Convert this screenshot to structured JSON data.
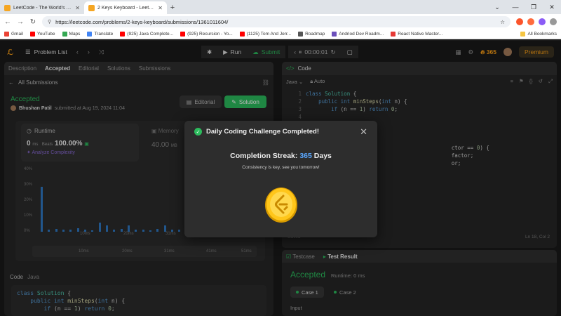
{
  "browser": {
    "tabs": [
      {
        "title": "LeetCode - The World's Leading Online Programming Learning Platform",
        "active": false
      },
      {
        "title": "2 Keys Keyboard - LeetCode",
        "active": true
      }
    ],
    "url": "https://leetcode.com/problems/2-keys-keyboard/submissions/1361011604/",
    "bookmarks": [
      {
        "label": "Gmail",
        "color": "#ea4335"
      },
      {
        "label": "YouTube",
        "color": "#ff0000"
      },
      {
        "label": "Maps",
        "color": "#34a853"
      },
      {
        "label": "Translate",
        "color": "#4285f4"
      },
      {
        "label": "(925) Java Complete...",
        "color": "#ff0000"
      },
      {
        "label": "(925) Recursion - Yo...",
        "color": "#ff0000"
      },
      {
        "label": "(1125) Tom And Jerr...",
        "color": "#ff0000"
      },
      {
        "label": "Roadmap",
        "color": "#555555"
      },
      {
        "label": "Andriod Dev Roadm...",
        "color": "#6b4fbb"
      },
      {
        "label": "React Native Master...",
        "color": "#e53935"
      }
    ],
    "all_bookmarks": "All Bookmarks"
  },
  "topbar": {
    "problem_list": "Problem List",
    "run": "Run",
    "submit": "Submit",
    "timer": "00:00:01",
    "streak": "365",
    "premium": "Premium"
  },
  "left": {
    "tabs": [
      "Description",
      "Accepted",
      "Editorial",
      "Solutions",
      "Submissions"
    ],
    "all_submissions": "All Submissions",
    "status": "Accepted",
    "author": "Bhushan Patil",
    "submitted": "submitted at Aug 19, 2024 11:04",
    "editorial_btn": "Editorial",
    "solution_btn": "Solution",
    "runtime": {
      "label": "Runtime",
      "value": "0",
      "unit": "ms",
      "beats_label": "Beats",
      "beats": "100.00%",
      "analyze": "Analyze Complexity"
    },
    "memory": {
      "label": "Memory",
      "value": "40.00",
      "unit": "MB"
    },
    "code_label": "Code",
    "code_lang": "Java"
  },
  "chart_data": {
    "type": "bar",
    "y_ticks": [
      "40%",
      "30%",
      "20%",
      "10%",
      "0%"
    ],
    "ylim": [
      0,
      40
    ],
    "x_ticks": [
      "10ms",
      "20ms",
      "31ms",
      "41ms",
      "51ms"
    ],
    "range_ticks": [
      "10ms",
      "20ms",
      "31ms",
      "41ms",
      "51ms"
    ],
    "values": [
      29,
      1.5,
      2,
      1.5,
      1.5,
      2.5,
      1.5,
      1,
      6,
      4,
      1.5,
      2,
      4,
      1.5,
      1.5,
      1,
      2,
      4,
      1.5,
      1.5,
      1.5,
      1.5,
      1,
      1.5,
      1,
      1.5,
      1,
      1.5,
      1,
      1.5
    ]
  },
  "left_code": [
    [
      {
        "t": "class ",
        "c": "kw"
      },
      {
        "t": "Solution",
        "c": "cls"
      },
      {
        "t": " {",
        "c": "pl"
      }
    ],
    [
      {
        "t": "    ",
        "c": "pl"
      },
      {
        "t": "public int ",
        "c": "kw"
      },
      {
        "t": "minSteps",
        "c": "fn"
      },
      {
        "t": "(",
        "c": "pl"
      },
      {
        "t": "int ",
        "c": "kw"
      },
      {
        "t": "n) {",
        "c": "pl"
      }
    ],
    [
      {
        "t": "        ",
        "c": "pl"
      },
      {
        "t": "if ",
        "c": "kw"
      },
      {
        "t": "(n == ",
        "c": "pl"
      },
      {
        "t": "1",
        "c": "num"
      },
      {
        "t": ") ",
        "c": "pl"
      },
      {
        "t": "return ",
        "c": "kw"
      },
      {
        "t": "0",
        "c": "num"
      },
      {
        "t": ";",
        "c": "pl"
      }
    ]
  ],
  "right": {
    "title": "Code",
    "lang": "Java",
    "auto": "Auto",
    "saved": "Saved",
    "cursor": "Ln 18, Col 2",
    "code": [
      [
        {
          "t": "class ",
          "c": "kw"
        },
        {
          "t": "Solution",
          "c": "cls"
        },
        {
          "t": " {",
          "c": "pl"
        }
      ],
      [
        {
          "t": "    ",
          "c": "pl"
        },
        {
          "t": "public int ",
          "c": "kw"
        },
        {
          "t": "minSteps",
          "c": "fn"
        },
        {
          "t": "(",
          "c": "pl"
        },
        {
          "t": "int ",
          "c": "kw"
        },
        {
          "t": "n) {",
          "c": "pl"
        }
      ],
      [
        {
          "t": "        ",
          "c": "pl"
        },
        {
          "t": "if ",
          "c": "kw"
        },
        {
          "t": "(n == ",
          "c": "pl"
        },
        {
          "t": "1",
          "c": "num"
        },
        {
          "t": ") ",
          "c": "pl"
        },
        {
          "t": "return ",
          "c": "kw"
        },
        {
          "t": "0",
          "c": "num"
        },
        {
          "t": ";",
          "c": "pl"
        }
      ],
      [],
      [],
      [],
      [],
      [
        {
          "t": "                                              ctor == ",
          "c": "pl"
        },
        {
          "t": "0",
          "c": "num"
        },
        {
          "t": ") {",
          "c": "pl"
        }
      ],
      [
        {
          "t": "                                              factor;",
          "c": "pl"
        }
      ],
      [
        {
          "t": "                                              or;",
          "c": "pl"
        }
      ]
    ]
  },
  "testresult": {
    "tabs": [
      "Testcase",
      "Test Result"
    ],
    "status": "Accepted",
    "runtime": "Runtime: 0 ms",
    "cases": [
      "Case 1",
      "Case 2"
    ],
    "input": "Input"
  },
  "modal": {
    "title": "Daily Coding Challenge Completed!",
    "streak_label": "Completion Streak:",
    "streak_value": "365",
    "streak_unit": "Days",
    "subtitle": "Consistency is key, see you tomorrow!"
  },
  "colors": {
    "accent_green": "#2cbb5d",
    "accent_orange": "#ffa116",
    "streak_blue": "#5aa7ff",
    "bar_blue": "#2e78c2"
  }
}
